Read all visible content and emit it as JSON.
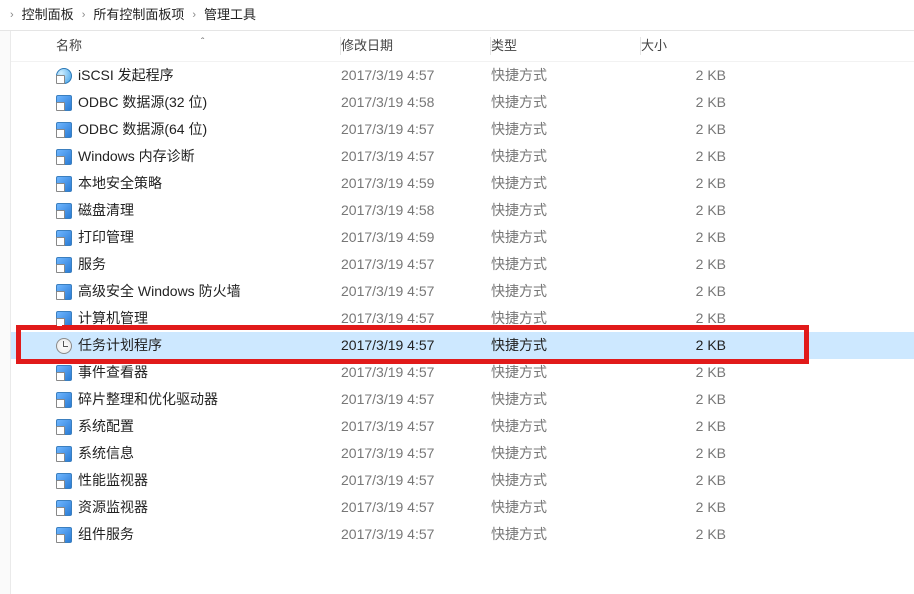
{
  "breadcrumb": {
    "items": [
      "控制面板",
      "所有控制面板项",
      "管理工具"
    ],
    "sep": "›"
  },
  "columns": {
    "name": "名称",
    "date": "修改日期",
    "type": "类型",
    "size": "大小",
    "sort_caret": "ˆ"
  },
  "type_label": "快捷方式",
  "rows": [
    {
      "icon": "globe-icon",
      "name": "iSCSI 发起程序",
      "date": "2017/3/19 4:57",
      "size": "2 KB",
      "selected": false
    },
    {
      "icon": "shortcut-icon",
      "name": "ODBC 数据源(32 位)",
      "date": "2017/3/19 4:58",
      "size": "2 KB",
      "selected": false
    },
    {
      "icon": "shortcut-icon",
      "name": "ODBC 数据源(64 位)",
      "date": "2017/3/19 4:57",
      "size": "2 KB",
      "selected": false
    },
    {
      "icon": "shortcut-icon",
      "name": "Windows 内存诊断",
      "date": "2017/3/19 4:57",
      "size": "2 KB",
      "selected": false
    },
    {
      "icon": "shortcut-icon",
      "name": "本地安全策略",
      "date": "2017/3/19 4:59",
      "size": "2 KB",
      "selected": false
    },
    {
      "icon": "shortcut-icon",
      "name": "磁盘清理",
      "date": "2017/3/19 4:58",
      "size": "2 KB",
      "selected": false
    },
    {
      "icon": "shortcut-icon",
      "name": "打印管理",
      "date": "2017/3/19 4:59",
      "size": "2 KB",
      "selected": false
    },
    {
      "icon": "shortcut-icon",
      "name": "服务",
      "date": "2017/3/19 4:57",
      "size": "2 KB",
      "selected": false
    },
    {
      "icon": "shortcut-icon",
      "name": "高级安全 Windows 防火墙",
      "date": "2017/3/19 4:57",
      "size": "2 KB",
      "selected": false
    },
    {
      "icon": "shortcut-icon",
      "name": "计算机管理",
      "date": "2017/3/19 4:57",
      "size": "2 KB",
      "selected": false
    },
    {
      "icon": "clock-icon",
      "name": "任务计划程序",
      "date": "2017/3/19 4:57",
      "size": "2 KB",
      "selected": true
    },
    {
      "icon": "shortcut-icon",
      "name": "事件查看器",
      "date": "2017/3/19 4:57",
      "size": "2 KB",
      "selected": false
    },
    {
      "icon": "shortcut-icon",
      "name": "碎片整理和优化驱动器",
      "date": "2017/3/19 4:57",
      "size": "2 KB",
      "selected": false
    },
    {
      "icon": "shortcut-icon",
      "name": "系统配置",
      "date": "2017/3/19 4:57",
      "size": "2 KB",
      "selected": false
    },
    {
      "icon": "shortcut-icon",
      "name": "系统信息",
      "date": "2017/3/19 4:57",
      "size": "2 KB",
      "selected": false
    },
    {
      "icon": "shortcut-icon",
      "name": "性能监视器",
      "date": "2017/3/19 4:57",
      "size": "2 KB",
      "selected": false
    },
    {
      "icon": "shortcut-icon",
      "name": "资源监视器",
      "date": "2017/3/19 4:57",
      "size": "2 KB",
      "selected": false
    },
    {
      "icon": "shortcut-icon",
      "name": "组件服务",
      "date": "2017/3/19 4:57",
      "size": "2 KB",
      "selected": false
    }
  ],
  "highlight": {
    "row_index": 10,
    "color": "#e11a1a"
  }
}
